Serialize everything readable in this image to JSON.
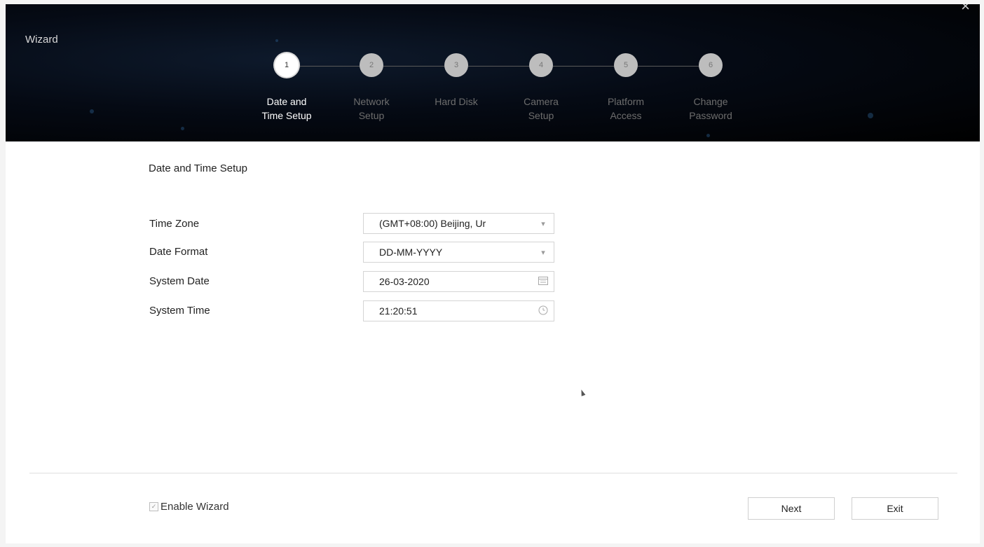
{
  "window": {
    "title": "Wizard",
    "close_glyph": "×"
  },
  "steps": [
    {
      "number": "1",
      "label": "Date and\nTime Setup",
      "active": true
    },
    {
      "number": "2",
      "label": "Network\nSetup",
      "active": false
    },
    {
      "number": "3",
      "label": "Hard Disk",
      "active": false
    },
    {
      "number": "4",
      "label": "Camera\nSetup",
      "active": false
    },
    {
      "number": "5",
      "label": "Platform\nAccess",
      "active": false
    },
    {
      "number": "6",
      "label": "Change\nPassword",
      "active": false
    }
  ],
  "form": {
    "section_title": "Date and Time Setup",
    "time_zone": {
      "label": "Time Zone",
      "value": "(GMT+08:00) Beijing, Ur",
      "icon": "chevron-down-icon"
    },
    "date_format": {
      "label": "Date Format",
      "value": "DD-MM-YYYY",
      "icon": "chevron-down-icon"
    },
    "system_date": {
      "label": "System Date",
      "value": "26-03-2020",
      "icon": "calendar-icon"
    },
    "system_time": {
      "label": "System Time",
      "value": "21:20:51",
      "icon": "clock-icon"
    }
  },
  "footer": {
    "enable_wizard_label": "Enable Wizard",
    "enable_wizard_checked": true,
    "next_label": "Next",
    "exit_label": "Exit"
  },
  "colors": {
    "header_bg": "#000000",
    "active_step": "#ffffff",
    "inactive_step": "#bdbdbd"
  }
}
